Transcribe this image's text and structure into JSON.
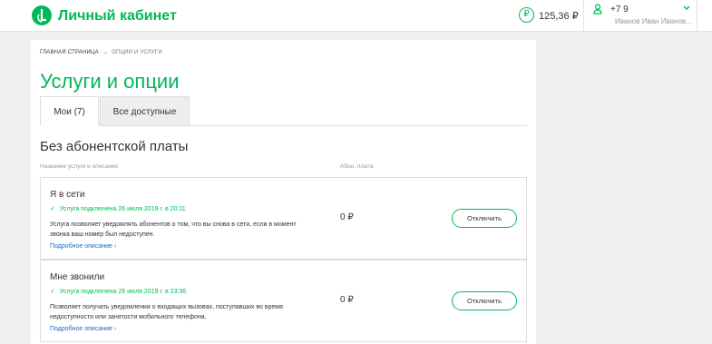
{
  "header": {
    "brand": "Личный кабинет",
    "balance": "125,36 ₽",
    "balance_icon": "₽",
    "user_phone": "+7 9",
    "user_name": "Иванов Иван Иванов..."
  },
  "breadcrumb": {
    "home": "ГЛАВНАЯ СТРАНИЦА",
    "arrow": "→",
    "current": "ОПЦИИ И УСЛУГИ"
  },
  "page": {
    "title": "Услуги и опции",
    "tabs": [
      {
        "label": "Мои (7)",
        "active": true
      },
      {
        "label": "Все доступные",
        "active": false
      }
    ],
    "section_title": "Без абонентской платы",
    "col_name": "Название услуги и описание",
    "col_fee": "Абон. плата:"
  },
  "services": [
    {
      "name": "Я в сети",
      "status": "Услуга подключена 26 июля 2019 г. в 20:11",
      "description": "Услуга позволяет уведомлять абонентов о том, что вы снова в сети, если в момент звонка ваш номер был недоступен.",
      "more": "Подробное описание ›",
      "price": "0 ₽",
      "button": "Отключить"
    },
    {
      "name": "Мне звонили",
      "status": "Услуга подключена 26 июля 2019 г. в 23:36",
      "description": "Позволяет получать уведомления о входящих вызовах, поступавших во время недоступности или занятости мобильного телефона.",
      "more": "Подробное описание ›",
      "price": "0 ₽",
      "button": "Отключить"
    }
  ],
  "colors": {
    "accent": "#00b956",
    "link": "#1b6ac9"
  }
}
